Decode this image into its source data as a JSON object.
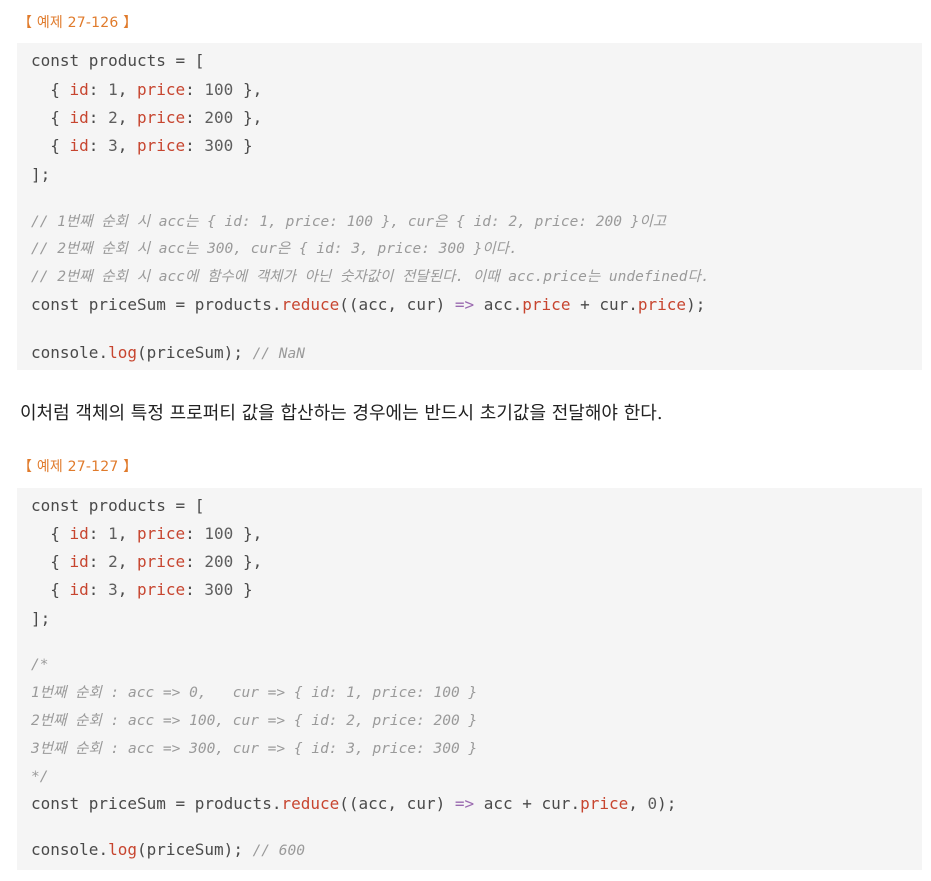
{
  "example1": {
    "label": "【 예제 27-126 】",
    "lines": [
      {
        "t": [
          [
            "kw",
            "const "
          ],
          [
            "obj",
            "products = ["
          ]
        ]
      },
      {
        "t": [
          [
            "obj",
            "  { "
          ],
          [
            "prop",
            "id"
          ],
          [
            "obj",
            ": "
          ],
          [
            "num",
            "1"
          ],
          [
            "obj",
            ", "
          ],
          [
            "prop",
            "price"
          ],
          [
            "obj",
            ": "
          ],
          [
            "num",
            "100"
          ],
          [
            "obj",
            " },"
          ]
        ]
      },
      {
        "t": [
          [
            "obj",
            "  { "
          ],
          [
            "prop",
            "id"
          ],
          [
            "obj",
            ": "
          ],
          [
            "num",
            "2"
          ],
          [
            "obj",
            ", "
          ],
          [
            "prop",
            "price"
          ],
          [
            "obj",
            ": "
          ],
          [
            "num",
            "200"
          ],
          [
            "obj",
            " },"
          ]
        ]
      },
      {
        "t": [
          [
            "obj",
            "  { "
          ],
          [
            "prop",
            "id"
          ],
          [
            "obj",
            ": "
          ],
          [
            "num",
            "3"
          ],
          [
            "obj",
            ", "
          ],
          [
            "prop",
            "price"
          ],
          [
            "obj",
            ": "
          ],
          [
            "num",
            "300"
          ],
          [
            "obj",
            " }"
          ]
        ]
      },
      {
        "t": [
          [
            "obj",
            "];"
          ]
        ]
      },
      {
        "t": [
          [
            "cmt",
            "// 1번째 순회 시 acc는 { id: 1, price: 100 }, cur은 { id: 2, price: 200 }이고"
          ]
        ]
      },
      {
        "t": [
          [
            "cmt",
            "// 2번째 순회 시 acc는 300, cur은 { id: 3, price: 300 }이다."
          ]
        ]
      },
      {
        "t": [
          [
            "cmt",
            "// 2번째 순회 시 acc에 함수에 객체가 아닌 숫자값이 전달된다. 이때 acc.price는 undefined다."
          ]
        ]
      },
      {
        "t": [
          [
            "kw",
            "const "
          ],
          [
            "obj",
            "priceSum = products."
          ],
          [
            "fn",
            "reduce"
          ],
          [
            "obj",
            "((acc, cur) "
          ],
          [
            "op",
            "=>"
          ],
          [
            "obj",
            " acc."
          ],
          [
            "prop",
            "price"
          ],
          [
            "obj",
            " + cur."
          ],
          [
            "prop",
            "price"
          ],
          [
            "obj",
            ");"
          ]
        ]
      },
      {
        "t": [
          [
            "kw",
            "console"
          ],
          [
            "obj",
            "."
          ],
          [
            "fn",
            "log"
          ],
          [
            "obj",
            "(priceSum); "
          ],
          [
            "cmt",
            "// NaN"
          ]
        ]
      }
    ]
  },
  "paragraph": "이처럼 객체의 특정 프로퍼티 값을 합산하는 경우에는 반드시 초기값을 전달해야 한다.",
  "example2": {
    "label": "【 예제 27-127 】",
    "lines": [
      {
        "t": [
          [
            "kw",
            "const "
          ],
          [
            "obj",
            "products = ["
          ]
        ]
      },
      {
        "t": [
          [
            "obj",
            "  { "
          ],
          [
            "prop",
            "id"
          ],
          [
            "obj",
            ": "
          ],
          [
            "num",
            "1"
          ],
          [
            "obj",
            ", "
          ],
          [
            "prop",
            "price"
          ],
          [
            "obj",
            ": "
          ],
          [
            "num",
            "100"
          ],
          [
            "obj",
            " },"
          ]
        ]
      },
      {
        "t": [
          [
            "obj",
            "  { "
          ],
          [
            "prop",
            "id"
          ],
          [
            "obj",
            ": "
          ],
          [
            "num",
            "2"
          ],
          [
            "obj",
            ", "
          ],
          [
            "prop",
            "price"
          ],
          [
            "obj",
            ": "
          ],
          [
            "num",
            "200"
          ],
          [
            "obj",
            " },"
          ]
        ]
      },
      {
        "t": [
          [
            "obj",
            "  { "
          ],
          [
            "prop",
            "id"
          ],
          [
            "obj",
            ": "
          ],
          [
            "num",
            "3"
          ],
          [
            "obj",
            ", "
          ],
          [
            "prop",
            "price"
          ],
          [
            "obj",
            ": "
          ],
          [
            "num",
            "300"
          ],
          [
            "obj",
            " }"
          ]
        ]
      },
      {
        "t": [
          [
            "obj",
            "];"
          ]
        ]
      },
      {
        "t": [
          [
            "cmt",
            "/*"
          ]
        ]
      },
      {
        "t": [
          [
            "cmt",
            "1번째 순회 : acc => 0,   cur => { id: 1, price: 100 }"
          ]
        ]
      },
      {
        "t": [
          [
            "cmt",
            "2번째 순회 : acc => 100, cur => { id: 2, price: 200 }"
          ]
        ]
      },
      {
        "t": [
          [
            "cmt",
            "3번째 순회 : acc => 300, cur => { id: 3, price: 300 }"
          ]
        ]
      },
      {
        "t": [
          [
            "cmt",
            "*/"
          ]
        ]
      },
      {
        "t": [
          [
            "kw",
            "const "
          ],
          [
            "obj",
            "priceSum = products."
          ],
          [
            "fn",
            "reduce"
          ],
          [
            "obj",
            "((acc, cur) "
          ],
          [
            "op",
            "=>"
          ],
          [
            "obj",
            " acc + cur."
          ],
          [
            "prop",
            "price"
          ],
          [
            "obj",
            ", "
          ],
          [
            "num",
            "0"
          ],
          [
            "obj",
            ");"
          ]
        ]
      },
      {
        "t": [
          [
            "kw",
            "console"
          ],
          [
            "obj",
            "."
          ],
          [
            "fn",
            "log"
          ],
          [
            "obj",
            "(priceSum); "
          ],
          [
            "cmt",
            "// 600"
          ]
        ]
      }
    ]
  }
}
